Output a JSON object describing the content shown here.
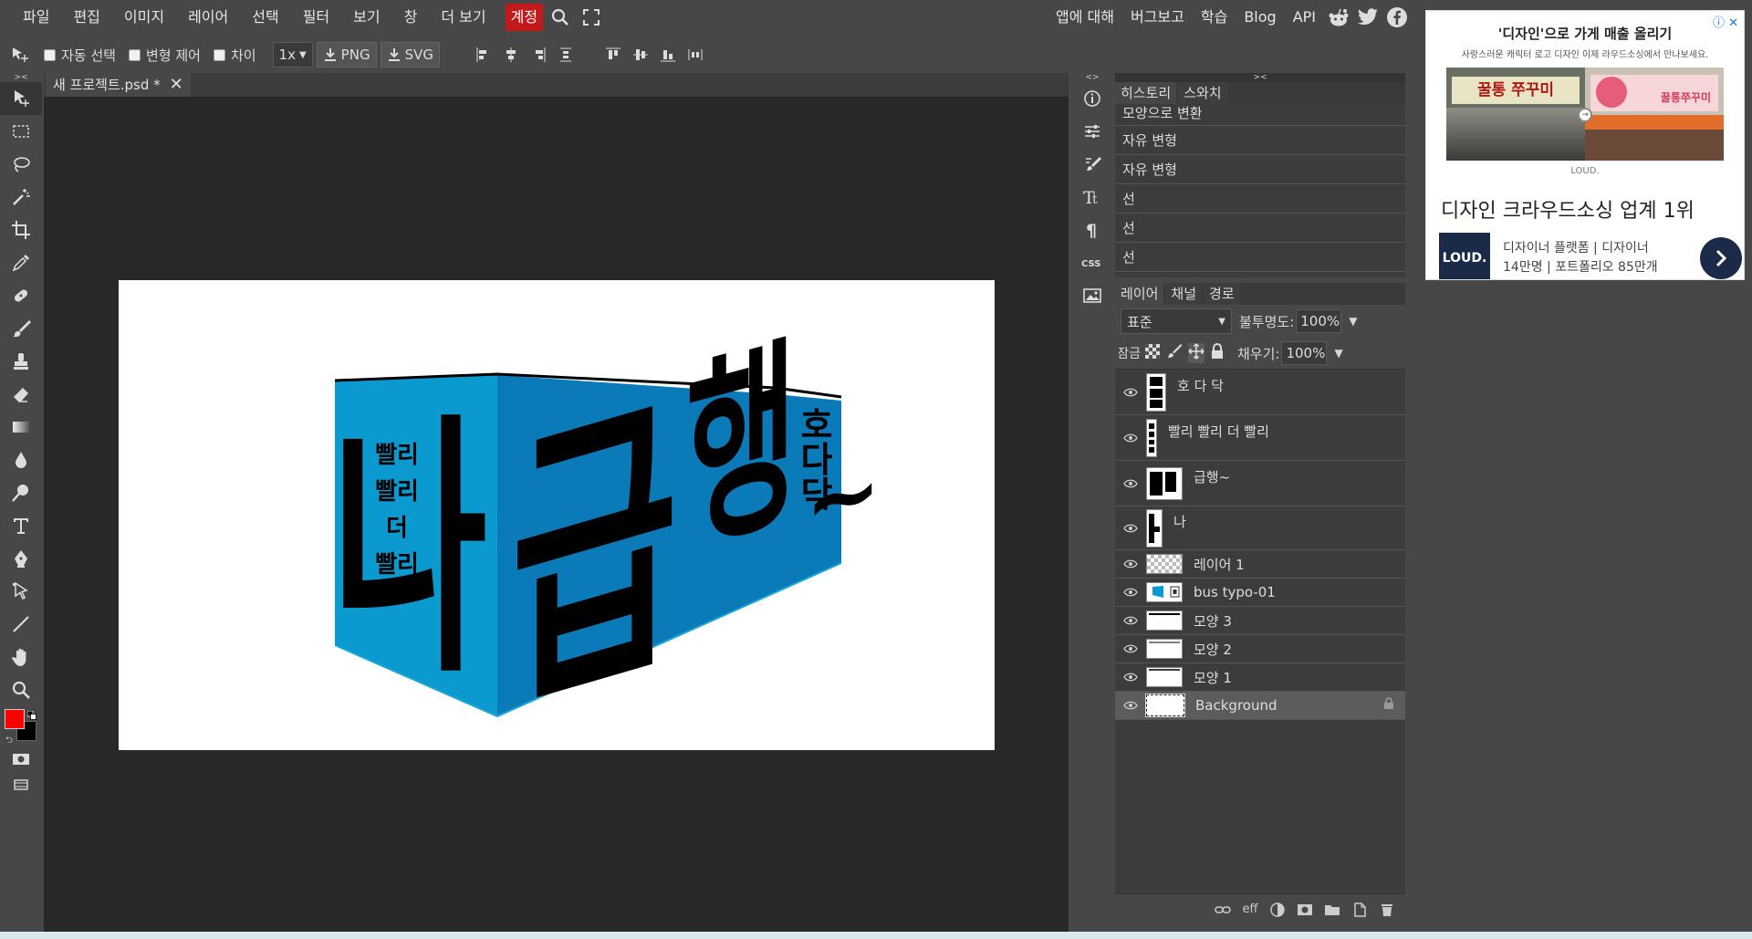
{
  "menubar": {
    "items": [
      "파일",
      "편집",
      "이미지",
      "레이어",
      "선택",
      "필터",
      "보기",
      "창",
      "더 보기"
    ],
    "account": "계정",
    "right_links": [
      "앱에 대해",
      "버그보고",
      "학습",
      "Blog",
      "API"
    ]
  },
  "options": {
    "auto_select": "자동 선택",
    "transform_controls": "변형 제어",
    "distances": "차이",
    "scale": "1x",
    "png": "PNG",
    "svg": "SVG"
  },
  "document": {
    "tab_title": "새 프로젝트.psd *",
    "artwork": {
      "small_text": [
        "빨리",
        "빨리",
        "더",
        "빨리"
      ],
      "big_left": "나",
      "big_mid": "급",
      "big_right": "행",
      "tilde": "~",
      "vertical_text": [
        "호",
        "다",
        "닥"
      ],
      "colors": {
        "front": "#0a7ab8",
        "side": "#0b9ad0",
        "ink": "#000000"
      }
    }
  },
  "history": {
    "tabs": [
      "히스토리",
      "스와치"
    ],
    "items": [
      "모양으로 변환",
      "자유 변형",
      "자유 변형",
      "선",
      "선",
      "선"
    ]
  },
  "layers_panel": {
    "tabs": [
      "레이어",
      "채널",
      "경로"
    ],
    "blend_mode": "표준",
    "opacity_label": "불투명도:",
    "opacity_value": "100%",
    "lock_label": "잠금:",
    "fill_label": "채우기:",
    "fill_value": "100%",
    "layers": [
      {
        "name": "호 다 닥"
      },
      {
        "name": "빨리 빨리 더 빨리"
      },
      {
        "name": "급행~"
      },
      {
        "name": "나"
      },
      {
        "name": "레이어 1"
      },
      {
        "name": "bus typo-01"
      },
      {
        "name": "모양 3"
      },
      {
        "name": "모양 2"
      },
      {
        "name": "모양 1"
      },
      {
        "name": "Background"
      }
    ],
    "footer_eff": "eff"
  },
  "ad": {
    "headline": "'디자인'으로 가게 매출 올리기",
    "sub": "사랑스러운 캐릭터 로고 디자인 이제 라우드소싱에서 만나보세요.",
    "sign_left": "꿀통 쭈꾸미",
    "sign_right": "꿀통쭈꾸미",
    "logo_small": "LOUD.",
    "title": "디자인 크라우드소싱 업계 1위",
    "brand": "LOUD.",
    "desc_line1": "디자이너 플랫폼 | 디자이너",
    "desc_line2": "14만명 | 포트폴리오 85만개"
  }
}
